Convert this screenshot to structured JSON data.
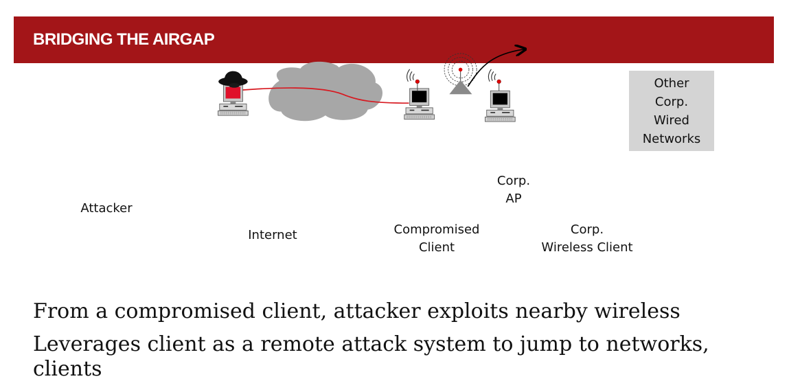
{
  "slide": {
    "title": "BRIDGING THE AIRGAP",
    "accent_color": "#a31518"
  },
  "diagram": {
    "nodes": {
      "attacker": "Attacker",
      "internet": "Internet",
      "compromised_line1": "Compromised",
      "compromised_line2": "Client",
      "ap_line1": "Corp.",
      "ap_line2": "AP",
      "wireless_line1": "Corp.",
      "wireless_line2": "Wireless Client",
      "other_lines": [
        "Other",
        "Corp.",
        "Wired",
        "Networks"
      ]
    },
    "link_color": "#d71920"
  },
  "bullets": [
    "From a compromised client, attacker exploits nearby wireless",
    "Leverages client as a remote attack system to jump to networks, clients"
  ]
}
